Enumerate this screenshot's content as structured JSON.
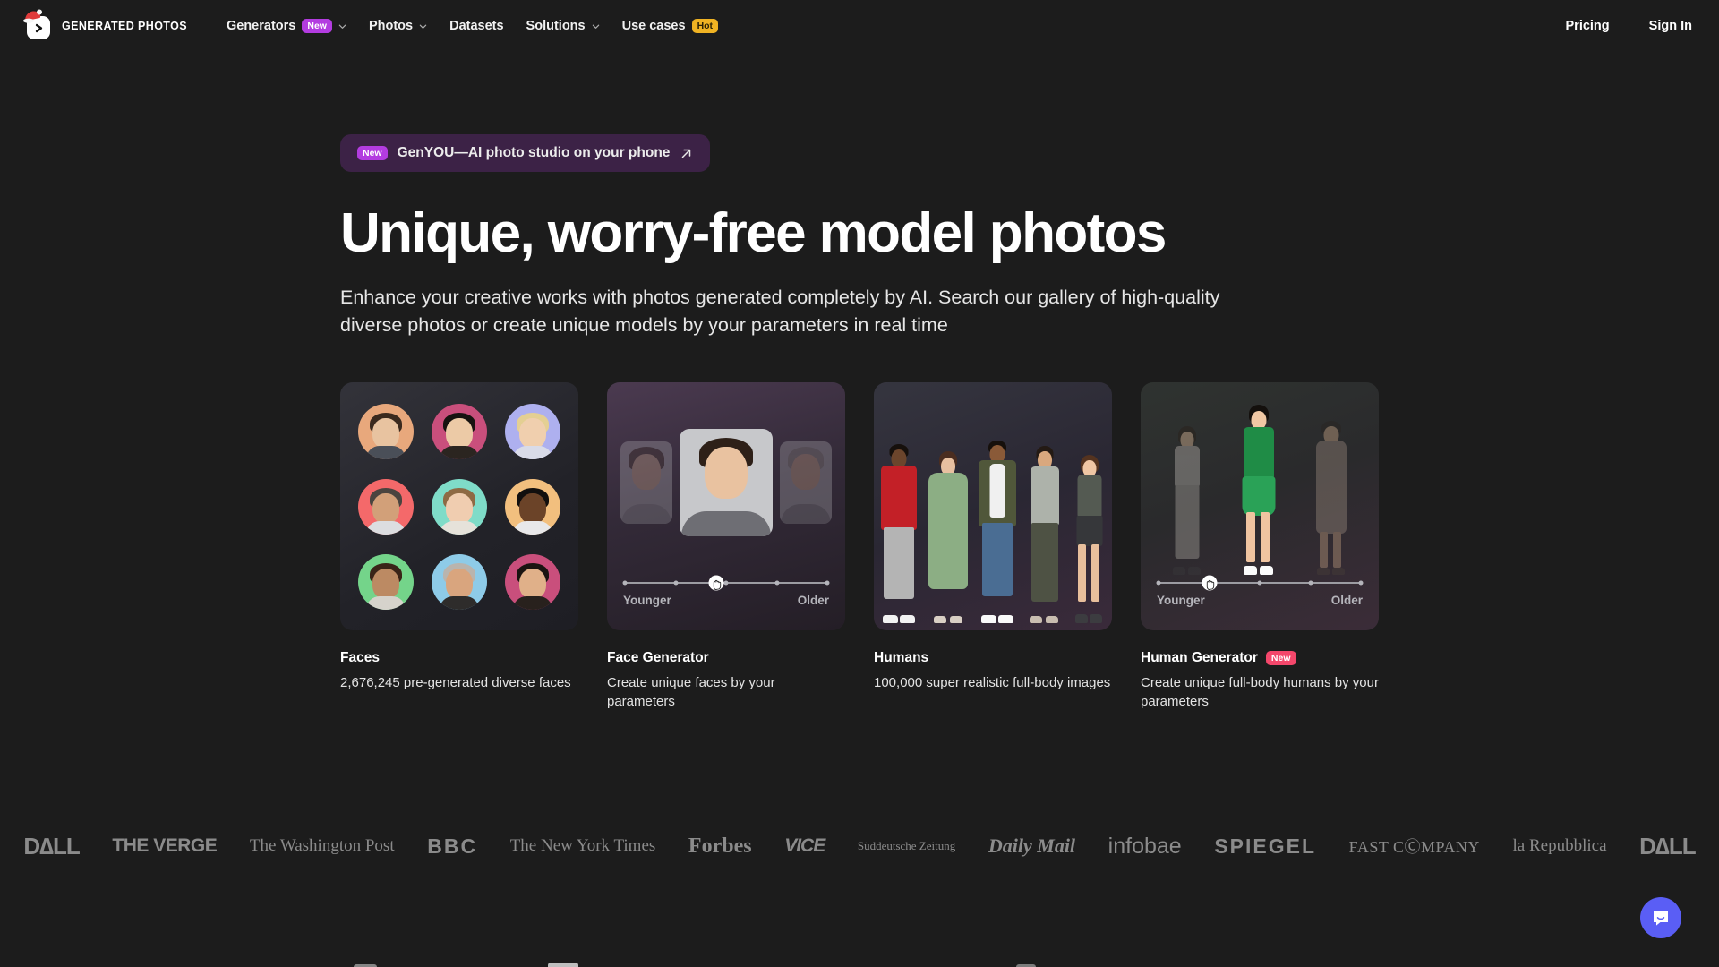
{
  "navbar": {
    "brand": {
      "name": "GENERATED PHOTOS",
      "logo_icon": "chevron-right-logo-icon",
      "hat_icon": "santa-hat-icon"
    },
    "items": [
      {
        "label": "Generators",
        "badge": "New",
        "badge_color": "#b33ce0",
        "has_chevron": true
      },
      {
        "label": "Photos",
        "badge": null,
        "has_chevron": true
      },
      {
        "label": "Datasets",
        "badge": null,
        "has_chevron": false
      },
      {
        "label": "Solutions",
        "badge": null,
        "has_chevron": true
      },
      {
        "label": "Use cases",
        "badge": "Hot",
        "badge_color": "#f0b323",
        "has_chevron": false
      }
    ],
    "pricing": "Pricing",
    "sign_in": "Sign In"
  },
  "hero": {
    "promo": {
      "badge": "New",
      "text": "GenYOU—AI photo studio on your phone",
      "arrow_icon": "arrow-up-right-icon",
      "bg": "#3c2246"
    },
    "headline": "Unique, worry-free model photos",
    "subtitle": "Enhance your creative works with photos generated completely by AI. Search our gallery of high-quality diverse photos or create unique models by your parameters in real time"
  },
  "cards": [
    {
      "id": "faces",
      "title": "Faces",
      "badge": null,
      "description": "2,676,245 pre-generated diverse faces",
      "media": "faces-grid",
      "face_colors": [
        "#e8a87c",
        "#c94f7c",
        "#aeb0ef",
        "#f4696a",
        "#7fdcc8",
        "#f2bf7e",
        "#74d48a",
        "#8ecbe8",
        "#c94f7c"
      ]
    },
    {
      "id": "face-generator",
      "title": "Face Generator",
      "badge": null,
      "description": "Create unique faces by your parameters",
      "media": "face-carousel",
      "slider": {
        "left_label": "Younger",
        "right_label": "Older",
        "knob_percent": 45,
        "dot_percents": [
          0,
          25,
          50,
          75,
          100
        ]
      }
    },
    {
      "id": "humans",
      "title": "Humans",
      "badge": null,
      "description": "100,000 super realistic full-body images",
      "media": "humans-group"
    },
    {
      "id": "human-generator",
      "title": "Human Generator",
      "badge": "New",
      "badge_color": "#f4476b",
      "description": "Create unique full-body humans by your parameters",
      "media": "human-carousel",
      "slider": {
        "left_label": "Younger",
        "right_label": "Older",
        "knob_percent": 25,
        "dot_percents": [
          0,
          25,
          50,
          75,
          100
        ]
      }
    }
  ],
  "press_logos": [
    {
      "name": "DELL",
      "text": "D∆LL",
      "style": "pl-dell"
    },
    {
      "name": "THE VERGE",
      "text": "THE VERGE",
      "style": "pl-verge"
    },
    {
      "name": "The Washington Post",
      "text": "The Washington Post",
      "style": "pl-wapo"
    },
    {
      "name": "BBC",
      "text": "BBC",
      "style": "pl-bbc"
    },
    {
      "name": "The New York Times",
      "text": "The New York Times",
      "style": "pl-nyt"
    },
    {
      "name": "Forbes",
      "text": "Forbes",
      "style": "pl-forbes"
    },
    {
      "name": "VICE",
      "text": "VICE",
      "style": "pl-vice"
    },
    {
      "name": "Sueddeutsche Zeitung",
      "text": "Süddeutsche Zeitung",
      "style": "pl-sz"
    },
    {
      "name": "Daily Mail",
      "text": "Daily Mail",
      "style": "pl-dm"
    },
    {
      "name": "infobae",
      "text": "infobae",
      "style": "pl-infobae"
    },
    {
      "name": "SPIEGEL",
      "text": "SPIEGEL",
      "style": "pl-spiegel"
    },
    {
      "name": "FAST COMPANY",
      "text": "FAST CⒸMPANY",
      "style": "pl-fastco"
    },
    {
      "name": "la Repubblica",
      "text": "la Repubblica",
      "style": "pl-repubblica"
    },
    {
      "name": "DELL",
      "text": "D∆LL",
      "style": "pl-dell"
    }
  ],
  "chat": {
    "icon": "chat-bubble-smile-icon",
    "color": "#5a5ef5"
  }
}
